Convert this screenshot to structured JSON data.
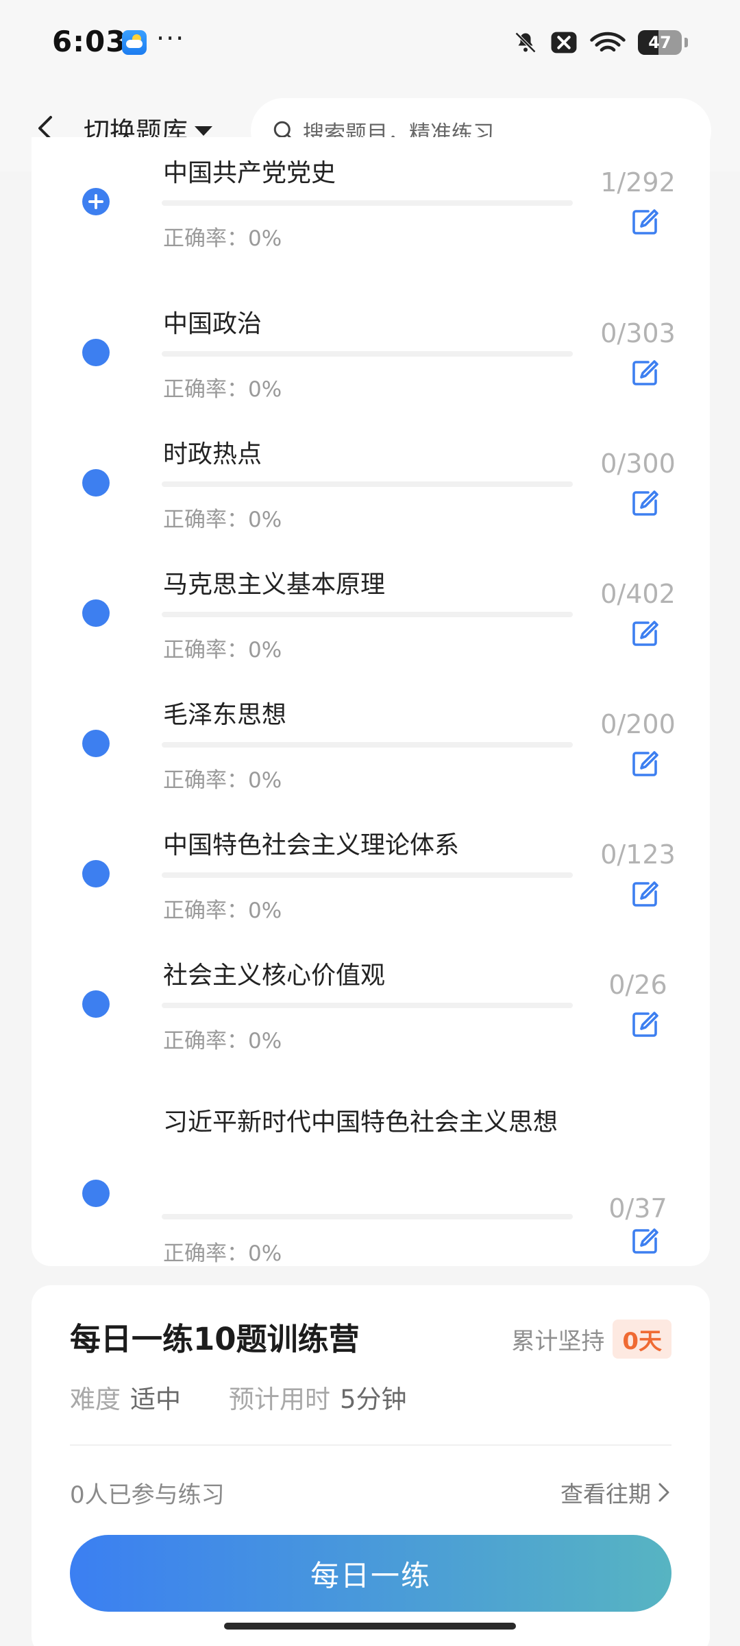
{
  "status": {
    "time": "6:03",
    "more": "···",
    "battery": "47",
    "battery_level": 0.47
  },
  "nav": {
    "title": "切换题库",
    "search_placeholder": "搜索题目，精准练习"
  },
  "subjects": [
    {
      "title": "中国共产党党史",
      "accuracy": "正确率：0%",
      "count": "1/292",
      "active": true
    },
    {
      "title": "中国政治",
      "accuracy": "正确率：0%",
      "count": "0/303"
    },
    {
      "title": "时政热点",
      "accuracy": "正确率：0%",
      "count": "0/300"
    },
    {
      "title": "马克思主义基本原理",
      "accuracy": "正确率：0%",
      "count": "0/402"
    },
    {
      "title": "毛泽东思想",
      "accuracy": "正确率：0%",
      "count": "0/200"
    },
    {
      "title": "中国特色社会主义理论体系",
      "accuracy": "正确率：0%",
      "count": "0/123"
    },
    {
      "title": "社会主义核心价值观",
      "accuracy": "正确率：0%",
      "count": "0/26"
    },
    {
      "title": "习近平新时代中国特色社会主义思想",
      "accuracy": "正确率：0%",
      "count": "0/37"
    }
  ],
  "training": {
    "title": "每日一练10题训练营",
    "streak_label": "累计坚持",
    "streak_value": "0天",
    "difficulty_label": "难度",
    "difficulty_value": "适中",
    "time_label": "预计用时",
    "time_value": "5分钟",
    "joined": "0人已参与练习",
    "history_link": "查看往期",
    "button": "每日一练"
  },
  "colors": {
    "accent": "#3d7ff0",
    "streak": "#ef6a33"
  }
}
